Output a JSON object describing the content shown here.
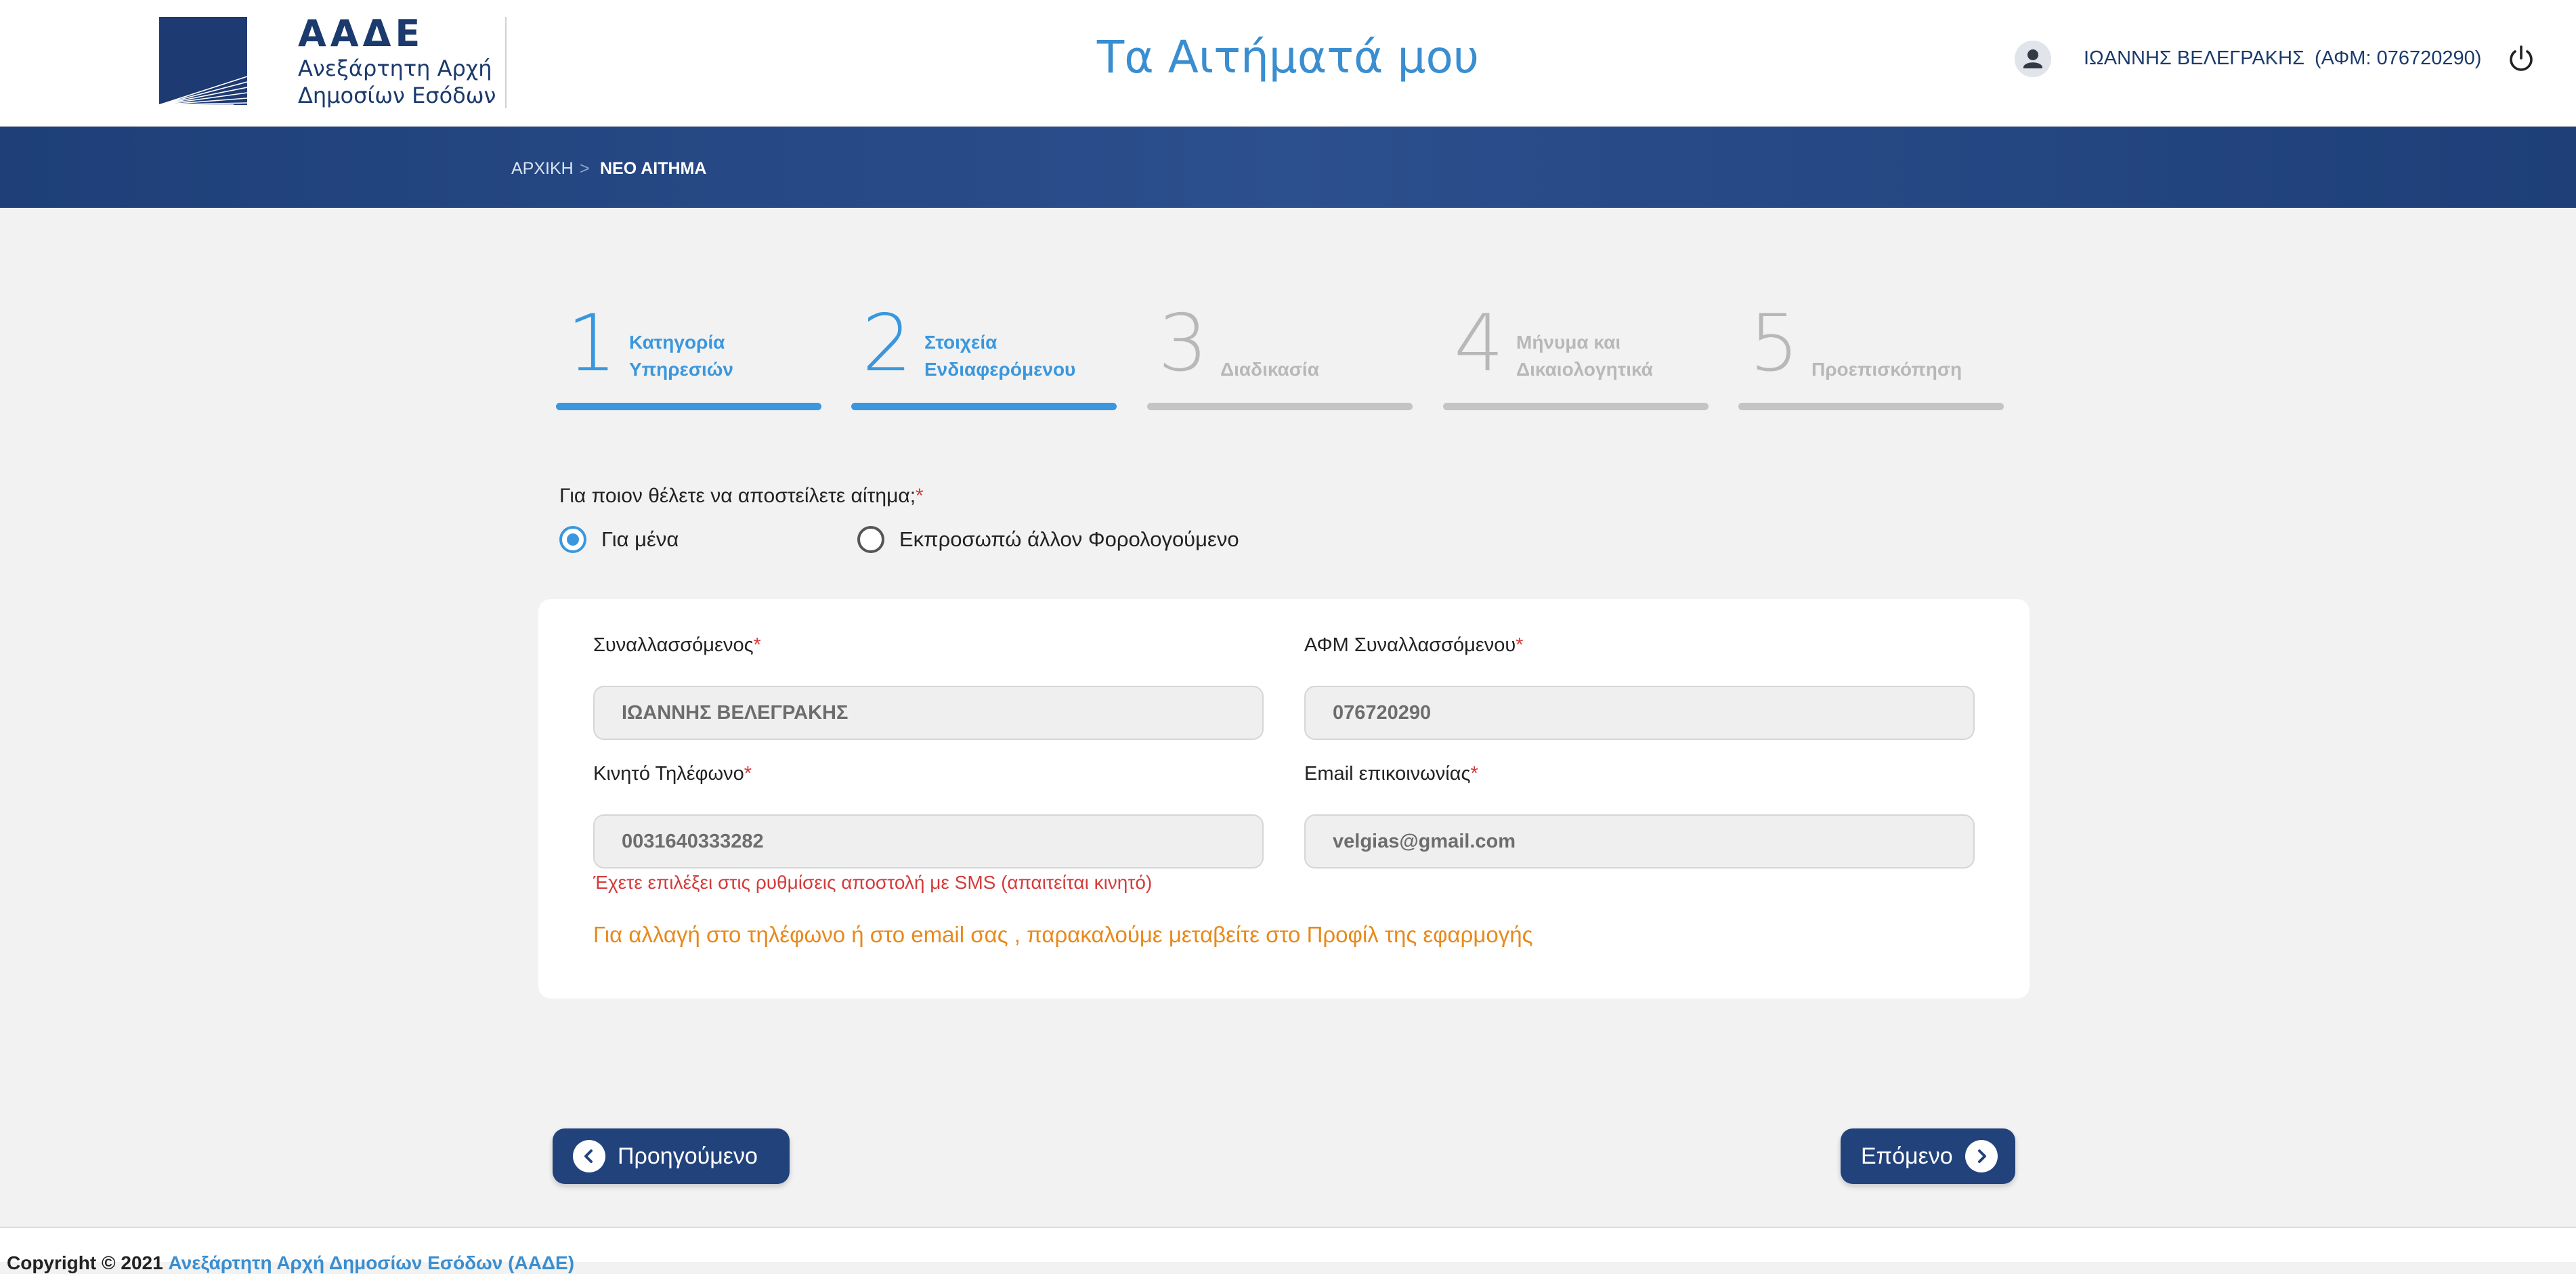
{
  "header": {
    "logo_abbr": "ΑΑΔΕ",
    "logo_line1": "Ανεξάρτητη Αρχή",
    "logo_line2": "Δημοσίων Εσόδων",
    "title": "Τα Αιτήματά μου",
    "user_name": "ΙΩΑΝΝΗΣ ΒΕΛΕΓΡΑΚΗΣ",
    "user_afm": "(ΑΦΜ: 076720290)",
    "brand_color": "#1b3a6d",
    "accent_color": "#3a8ed0"
  },
  "breadcrumb": {
    "home": "ΑΡΧΙΚΗ",
    "separator": ">",
    "current": "ΝΕΟ ΑΙΤΗΜΑ"
  },
  "steps": [
    {
      "number": "1",
      "label": "Κατηγορία Υπηρεσιών",
      "state": "completed"
    },
    {
      "number": "2",
      "label": "Στοιχεία Ενδιαφερόμενου",
      "state": "current"
    },
    {
      "number": "3",
      "label": "Διαδικασία",
      "state": "upcoming"
    },
    {
      "number": "4",
      "label": "Μήνυμα και Δικαιολογητικά",
      "state": "upcoming"
    },
    {
      "number": "5",
      "label": "Προεπισκόπηση",
      "state": "upcoming"
    }
  ],
  "recipient": {
    "question": "Για ποιον θέλετε να αποστείλετε αίτημα;",
    "required_mark": "*",
    "option_me": "Για μένα",
    "option_other": "Εκπροσωπώ άλλον Φορολογούμενο",
    "selected": "option_me"
  },
  "form": {
    "name_label": "Συναλλασσόμενος",
    "name_value": "ΙΩΑΝΝΗΣ ΒΕΛΕΓΡΑΚΗΣ",
    "afm_label": "ΑΦΜ Συναλλασσόμενου",
    "afm_value": "076720290",
    "phone_label": "Κινητό Τηλέφωνο",
    "phone_value": "0031640333282",
    "email_label": "Email επικοινωνίας",
    "email_value": "velgias@gmail.com",
    "required_mark": "*",
    "sms_note": "Έχετε επιλέξει στις ρυθμίσεις αποστολή με SMS (απαιτείται κινητό)",
    "profile_note": "Για αλλαγή στο τηλέφωνο ή στο email σας , παρακαλούμε μεταβείτε στο Προφίλ της εφαρμογής"
  },
  "nav": {
    "prev_label": "Προηγούμενο",
    "next_label": "Επόμενο"
  },
  "footer": {
    "copyright": "Copyright © 2021",
    "link": "Ανεξάρτητη Αρχή Δημοσίων Εσόδων (ΑΑΔΕ)"
  }
}
